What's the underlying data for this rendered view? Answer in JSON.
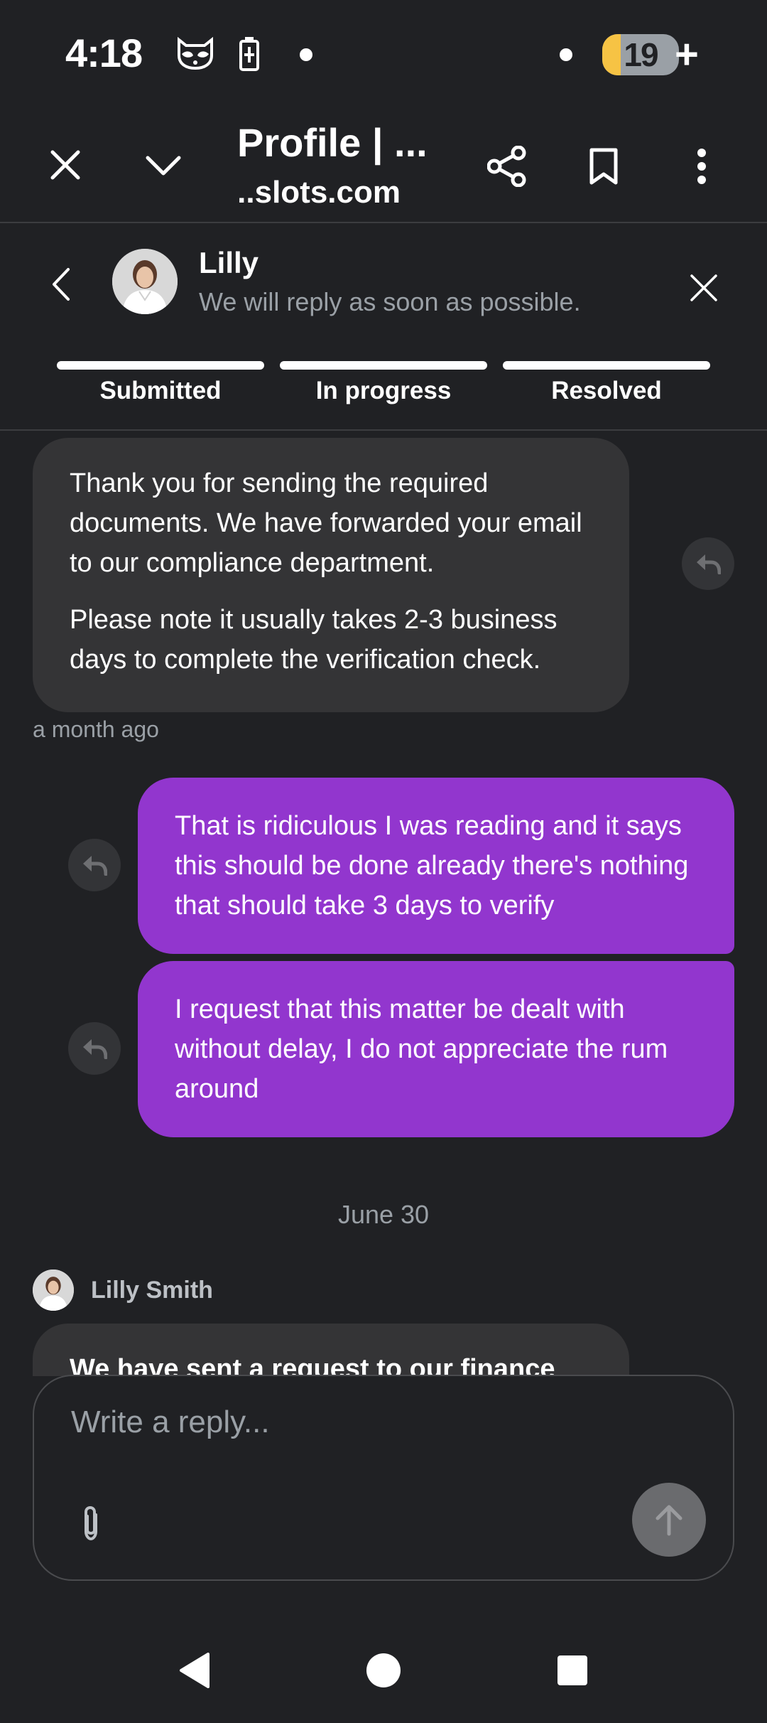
{
  "status_bar": {
    "time": "4:18",
    "battery_level": "19",
    "battery_fraction": 0.19
  },
  "browser": {
    "title": "Profile | ...",
    "url": "...slots.com"
  },
  "chat_header": {
    "agent_name": "Lilly",
    "subtitle": "We will reply as soon as possible.",
    "steps": [
      "Submitted",
      "In progress",
      "Resolved"
    ]
  },
  "messages": {
    "incoming_1": {
      "para1": "Thank you for sending the required documents. We have forwarded your email to our compliance department.",
      "para2": "Please note it usually takes 2-3 business days to complete the verification check."
    },
    "incoming_1_time": "a month ago",
    "outgoing_1": "That is ridiculous I was reading and it says this should be done already there's nothing that should take 3 days to verify",
    "outgoing_2": "I request that this matter be dealt with without delay, I do not appreciate the rum around",
    "date_separator": "June 30",
    "sender_name": "Lilly Smith",
    "incoming_2_partial": "We have sent a request to our finance"
  },
  "composer": {
    "placeholder": "Write a reply..."
  },
  "colors": {
    "background": "#202124",
    "incoming_bubble": "#343436",
    "outgoing_bubble": "#9236ce",
    "battery_accent": "#f6c344"
  },
  "icons": {
    "close": "close-icon",
    "collapse": "chevron-down-icon",
    "share": "share-icon",
    "bookmark": "bookmark-icon",
    "more": "more-vert-icon",
    "back": "chevron-left-icon",
    "reply": "reply-icon",
    "attach": "paperclip-icon",
    "send": "arrow-up-icon"
  }
}
